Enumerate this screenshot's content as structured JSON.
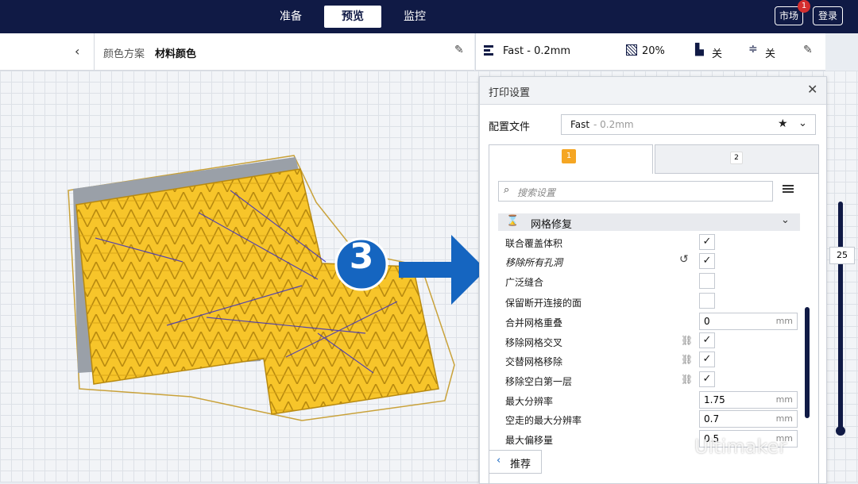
{
  "topbar": {
    "tabs": [
      "准备",
      "预览",
      "监控"
    ],
    "active_tab": "预览",
    "marketplace_label": "市场",
    "marketplace_badge": "1",
    "login_label": "登录"
  },
  "toolbar": {
    "back_icon": "chevron-left-icon",
    "color_scheme_label": "颜色方案",
    "color_scheme_value": "材料颜色",
    "edit_icon": "pencil-icon",
    "profile_summary": "Fast - 0.2mm",
    "infill_value": "20%",
    "support_value": "关",
    "adhesion_value": "关"
  },
  "print_settings": {
    "title": "打印设置",
    "profile_label": "配置文件",
    "profile_name": "Fast",
    "profile_layer": " - 0.2mm",
    "extruder_tabs": [
      "1",
      "2"
    ],
    "search_placeholder": "搜索设置",
    "category": "网格修复",
    "settings": [
      {
        "label": "联合覆盖体积",
        "type": "check",
        "value": "✓"
      },
      {
        "label": "移除所有孔洞",
        "type": "check",
        "value": "✓",
        "highlighted": true
      },
      {
        "label": "广泛缝合",
        "type": "check",
        "value": ""
      },
      {
        "label": "保留断开连接的面",
        "type": "check",
        "value": ""
      },
      {
        "label": "合并网格重叠",
        "type": "number",
        "value": "0",
        "unit": "mm"
      },
      {
        "label": "移除网格交叉",
        "type": "check",
        "value": "✓",
        "linked": true
      },
      {
        "label": "交替网格移除",
        "type": "check",
        "value": "✓",
        "linked": true
      },
      {
        "label": "移除空白第一层",
        "type": "check",
        "value": "✓",
        "linked": true
      },
      {
        "label": "最大分辨率",
        "type": "number",
        "value": "1.75",
        "unit": "mm"
      },
      {
        "label": "空走的最大分辨率",
        "type": "number",
        "value": "0.7",
        "unit": "mm"
      },
      {
        "label": "最大偏移量",
        "type": "number",
        "value": "0.5",
        "unit": "mm"
      }
    ],
    "recommended_label": "推荐"
  },
  "annotation": {
    "step_number": "3",
    "accent_color": "#1565c0"
  },
  "layer_slider": {
    "value": "25"
  },
  "watermark": {
    "text": "Ultimaker"
  },
  "colors": {
    "topbar": "#101a45",
    "model_yellow": "#f7c52a",
    "travel_blue": "#3a2fc0"
  }
}
